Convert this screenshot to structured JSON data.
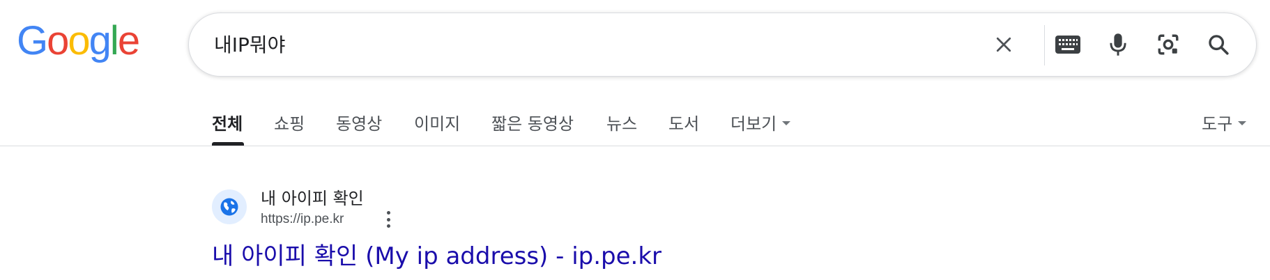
{
  "logo": {
    "letters": [
      "G",
      "o",
      "o",
      "g",
      "l",
      "e"
    ],
    "colors": [
      "#4285F4",
      "#EA4335",
      "#FBBC05",
      "#4285F4",
      "#34A853",
      "#EA4335"
    ]
  },
  "search": {
    "query": "내IP뭐야",
    "icons": {
      "clear": "close-icon",
      "keyboard": "keyboard-icon",
      "voice": "microphone-icon",
      "lens": "camera-lens-icon",
      "submit": "search-icon"
    }
  },
  "tabs": [
    {
      "label": "전체",
      "active": true
    },
    {
      "label": "쇼핑",
      "active": false
    },
    {
      "label": "동영상",
      "active": false
    },
    {
      "label": "이미지",
      "active": false
    },
    {
      "label": "짧은 동영상",
      "active": false
    },
    {
      "label": "뉴스",
      "active": false
    },
    {
      "label": "도서",
      "active": false
    },
    {
      "label": "더보기",
      "active": false
    }
  ],
  "tools_label": "도구",
  "results": [
    {
      "site_name": "내 아이피 확인",
      "url": "https://ip.pe.kr",
      "title": "내 아이피 확인 (My ip address) - ip.pe.kr",
      "favicon": "globe-icon"
    }
  ],
  "colors": {
    "link": "#1a0dab",
    "text": "#202124",
    "muted": "#4d5156",
    "icon_blue": "#1a73e8"
  }
}
